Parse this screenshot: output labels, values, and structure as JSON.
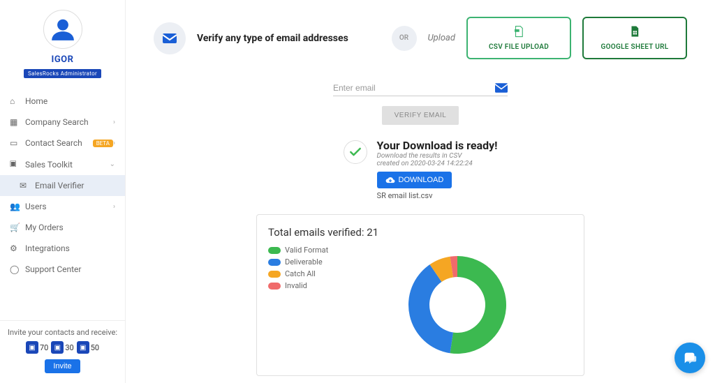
{
  "user": {
    "name": "IGOR",
    "role": "SalesRocks Administrator"
  },
  "nav": {
    "home": "Home",
    "company_search": "Company Search",
    "contact_search": "Contact Search",
    "beta": "BETA",
    "sales_toolkit": "Sales Toolkit",
    "email_verifier": "Email Verifier",
    "users": "Users",
    "my_orders": "My Orders",
    "integrations": "Integrations",
    "support_center": "Support Center"
  },
  "invite": {
    "title": "Invite your contacts and receive:",
    "r1": "70",
    "r2": "30",
    "r3": "50",
    "button": "Invite"
  },
  "header": {
    "title": "Verify any type of email addresses",
    "or": "OR",
    "upload": "Upload",
    "csv_btn": "CSV FILE UPLOAD",
    "gsheet_btn": "GOOGLE SHEET URL"
  },
  "input": {
    "placeholder": "Enter email",
    "verify_btn": "VERIFY EMAIL"
  },
  "download": {
    "title": "Your Download is ready!",
    "sub1": "Download the results in CSV",
    "sub2": "created on 2020-03-24 14:22:24",
    "btn": "DOWNLOAD",
    "filename": "SR email list.csv"
  },
  "chart": {
    "title_prefix": "Total emails verified: ",
    "total": "21",
    "legend": {
      "valid_format": "Valid Format",
      "deliverable": "Deliverable",
      "catch_all": "Catch All",
      "invalid": "Invalid"
    }
  },
  "chart_data": {
    "type": "pie",
    "title": "Total emails verified: 21",
    "series": [
      {
        "name": "Valid Format",
        "value": 11,
        "color": "#3cb950"
      },
      {
        "name": "Deliverable",
        "value": 8,
        "color": "#2a7de1"
      },
      {
        "name": "Catch All",
        "value": 1.5,
        "color": "#f5a623"
      },
      {
        "name": "Invalid",
        "value": 0.5,
        "color": "#f06b6b"
      }
    ]
  },
  "colors": {
    "valid_format": "#3cb950",
    "deliverable": "#2a7de1",
    "catch_all": "#f5a623",
    "invalid": "#f06b6b"
  }
}
